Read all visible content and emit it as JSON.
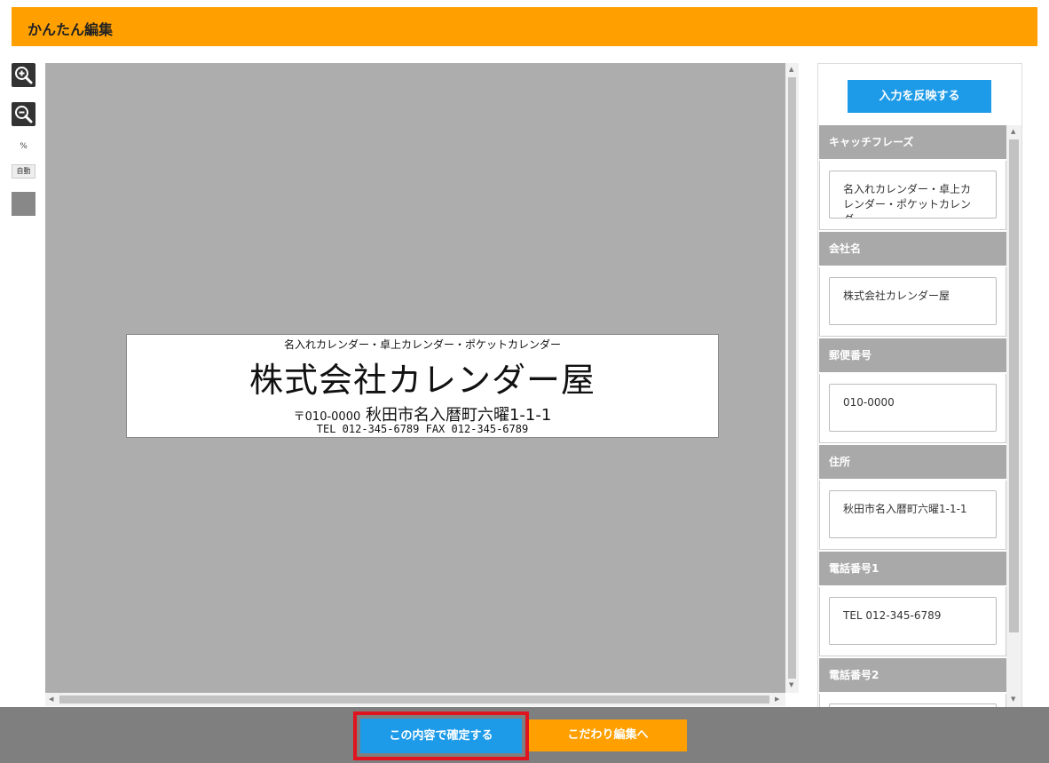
{
  "header": {
    "title": "かんたん編集"
  },
  "toolbar": {
    "percent_label": "%",
    "auto_label": "自動"
  },
  "preview": {
    "catchphrase": "名入れカレンダー・卓上カレンダー・ポケットカレンダー",
    "company": "株式会社カレンダー屋",
    "zip": "〒010-0000",
    "address": "秋田市名入暦町六曜1-1-1",
    "tel_line": "TEL 012-345-6789 FAX 012-345-6789"
  },
  "panel": {
    "reflect_label": "入力を反映する",
    "fields": [
      {
        "label": "キャッチフレーズ",
        "value": "名入れカレンダー・卓上カレンダー・ポケットカレンダー"
      },
      {
        "label": "会社名",
        "value": "株式会社カレンダー屋"
      },
      {
        "label": "郵便番号",
        "value": "010-0000"
      },
      {
        "label": "住所",
        "value": "秋田市名入暦町六曜1-1-1"
      },
      {
        "label": "電話番号1",
        "value": "TEL 012-345-6789"
      },
      {
        "label": "電話番号2",
        "value": ""
      }
    ]
  },
  "footer": {
    "confirm_label": "この内容で確定する",
    "advanced_label": "こだわり編集へ"
  },
  "colors": {
    "accent_orange": "#ffa000",
    "accent_blue": "#1e9be8",
    "highlight_red": "#e0141e"
  }
}
